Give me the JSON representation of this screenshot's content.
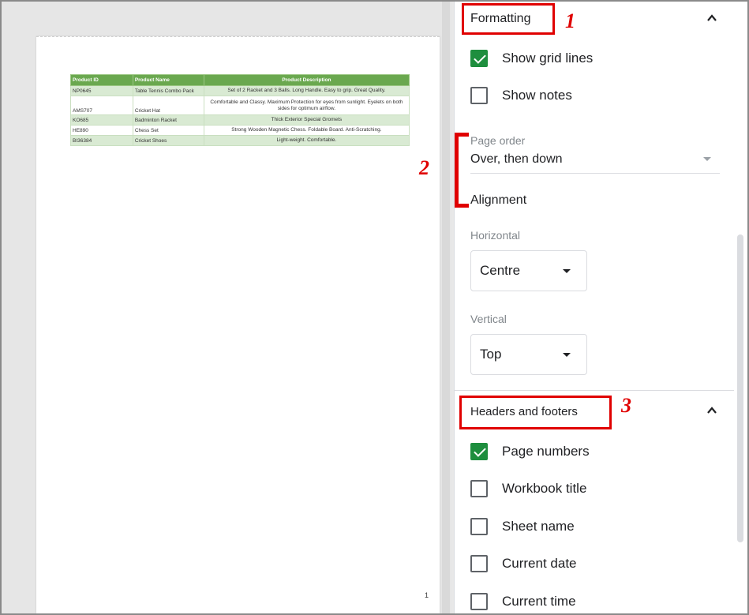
{
  "preview": {
    "table": {
      "headers": [
        "Product ID",
        "Product Name",
        "Product Description"
      ],
      "rows": [
        [
          "NP0645",
          "Table Tennis Combo Pack",
          "Set of 2 Racket and 3 Balls. Long Handle. Easy to grip. Great Quality."
        ],
        [
          "AMS707",
          "Cricket Hat",
          "Comfortable and Classy. Maximum Protection for eyes from sunlight. Eyelets on both sides for optimum airflow."
        ],
        [
          "KO685",
          "Badminton Racket",
          "Thick Exterior Special Gromets"
        ],
        [
          "HE890",
          "Chess Set",
          "Strong Wooden Magnetic Chess. Foldable Board. Anti-Scratching."
        ],
        [
          "BI36384",
          "Cricket Shoes",
          "Light-weight. Comfortable."
        ]
      ]
    },
    "page_number": "1"
  },
  "sidebar": {
    "formatting": {
      "title": "Formatting",
      "show_grid_lines": {
        "label": "Show grid lines",
        "checked": true
      },
      "show_notes": {
        "label": "Show notes",
        "checked": false
      },
      "page_order": {
        "label": "Page order",
        "value": "Over, then down"
      },
      "alignment": {
        "title": "Alignment",
        "horizontal": {
          "label": "Horizontal",
          "value": "Centre"
        },
        "vertical": {
          "label": "Vertical",
          "value": "Top"
        }
      }
    },
    "headers_footers": {
      "title": "Headers and footers",
      "items": [
        {
          "label": "Page numbers",
          "checked": true
        },
        {
          "label": "Workbook title",
          "checked": false
        },
        {
          "label": "Sheet name",
          "checked": false
        },
        {
          "label": "Current date",
          "checked": false
        },
        {
          "label": "Current time",
          "checked": false
        }
      ]
    }
  },
  "annotations": {
    "one": "1",
    "two": "2",
    "three": "3",
    "color": "#e00000"
  },
  "colors": {
    "checkbox_checked": "#1e8e3e",
    "table_header": "#6aa84f",
    "table_alt_row": "#d9ead3"
  }
}
